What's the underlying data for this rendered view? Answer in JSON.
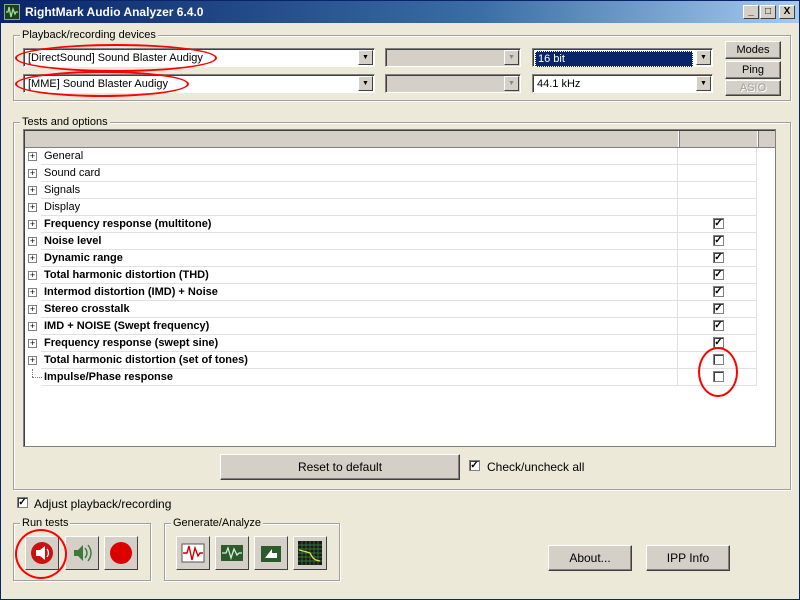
{
  "window": {
    "title": "RightMark Audio Analyzer 6.4.0",
    "minimize": "_",
    "maximize": "□",
    "close": "X"
  },
  "devices": {
    "group_label": "Playback/recording devices",
    "playback_device": "[DirectSound] Sound Blaster Audigy",
    "recording_device": "[MME] Sound Blaster Audigy",
    "bit_depth": "16 bit",
    "sample_rate": "44.1 kHz",
    "modes_label": "Modes",
    "ping_label": "Ping",
    "asio_label": "ASIO"
  },
  "tests": {
    "group_label": "Tests and options",
    "rows": [
      {
        "label": "General",
        "bold": false,
        "checkbox": false,
        "checked": false
      },
      {
        "label": "Sound card",
        "bold": false,
        "checkbox": false,
        "checked": false
      },
      {
        "label": "Signals",
        "bold": false,
        "checkbox": false,
        "checked": false
      },
      {
        "label": "Display",
        "bold": false,
        "checkbox": false,
        "checked": false
      },
      {
        "label": "Frequency response (multitone)",
        "bold": true,
        "checkbox": true,
        "checked": true
      },
      {
        "label": "Noise level",
        "bold": true,
        "checkbox": true,
        "checked": true
      },
      {
        "label": "Dynamic range",
        "bold": true,
        "checkbox": true,
        "checked": true
      },
      {
        "label": "Total harmonic distortion (THD)",
        "bold": true,
        "checkbox": true,
        "checked": true
      },
      {
        "label": "Intermod distortion (IMD) + Noise",
        "bold": true,
        "checkbox": true,
        "checked": true
      },
      {
        "label": "Stereo crosstalk",
        "bold": true,
        "checkbox": true,
        "checked": true
      },
      {
        "label": "IMD + NOISE (Swept frequency)",
        "bold": true,
        "checkbox": true,
        "checked": true
      },
      {
        "label": "Frequency response (swept sine)",
        "bold": true,
        "checkbox": true,
        "checked": true
      },
      {
        "label": "Total harmonic distortion (set of tones)",
        "bold": true,
        "checkbox": true,
        "checked": false
      },
      {
        "label": "Impulse/Phase response",
        "bold": true,
        "checkbox": true,
        "checked": false
      }
    ],
    "reset_label": "Reset to default",
    "check_all_label": "Check/uncheck all",
    "check_all_checked": true
  },
  "adjust": {
    "label": "Adjust playback/recording",
    "checked": true
  },
  "run_tests": {
    "group_label": "Run tests"
  },
  "generate": {
    "group_label": "Generate/Analyze"
  },
  "footer": {
    "about_label": "About...",
    "ipp_label": "IPP Info"
  },
  "colors": {
    "annotation": "#ff0000",
    "titlebar": "#0a246a",
    "face": "#d4d0c8",
    "selection": "#0a246a"
  },
  "icons": {
    "app": "waveform-icon",
    "run": [
      "speaker-play-icon",
      "speaker-loop-icon",
      "record-icon"
    ],
    "generate": [
      "generate-wave-icon",
      "analyze-wave-icon",
      "open-file-icon",
      "spectrum-grid-icon"
    ]
  }
}
